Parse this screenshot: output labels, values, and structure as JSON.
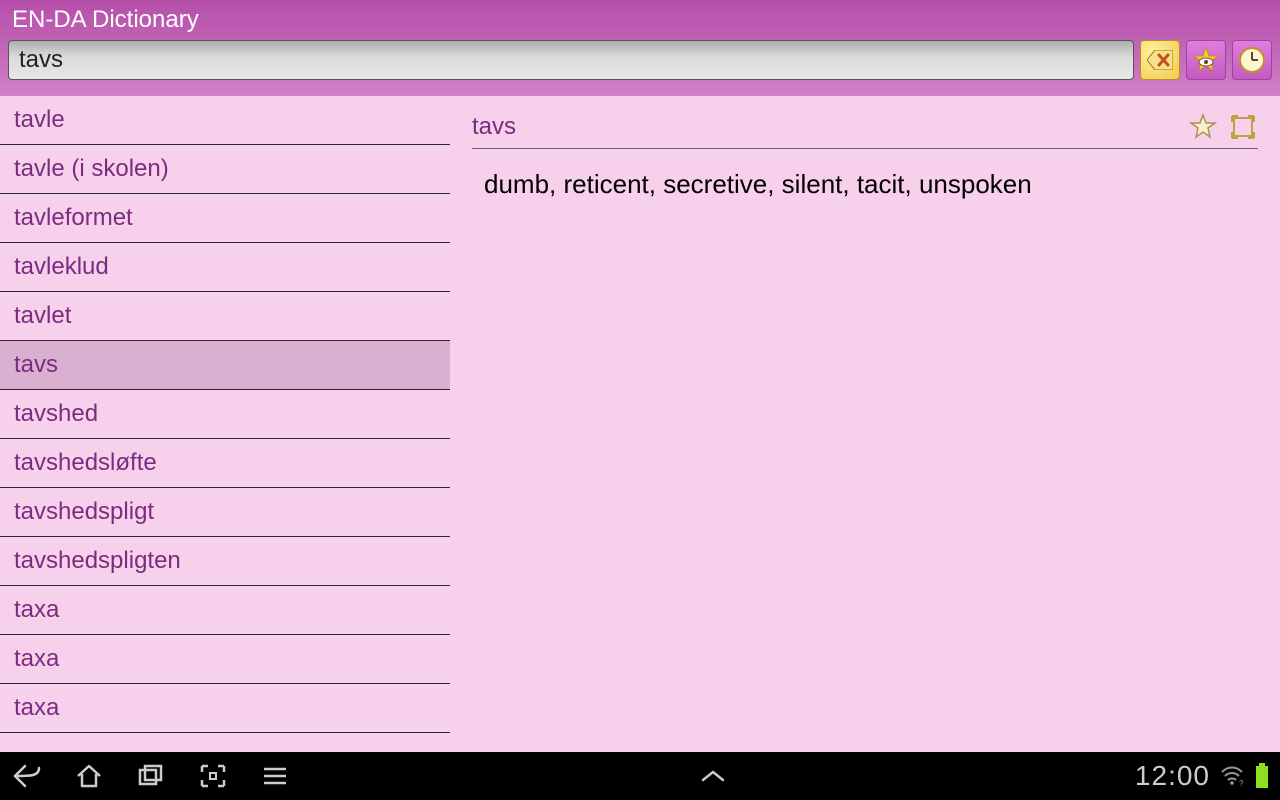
{
  "header": {
    "title": "EN-DA Dictionary",
    "search_value": "tavs"
  },
  "sidebar": {
    "items": [
      {
        "label": "tavle",
        "selected": false
      },
      {
        "label": "tavle (i skolen)",
        "selected": false
      },
      {
        "label": "tavleformet",
        "selected": false
      },
      {
        "label": "tavleklud",
        "selected": false
      },
      {
        "label": "tavlet",
        "selected": false
      },
      {
        "label": "tavs",
        "selected": true
      },
      {
        "label": "tavshed",
        "selected": false
      },
      {
        "label": "tavshedsløfte",
        "selected": false
      },
      {
        "label": "tavshedspligt",
        "selected": false
      },
      {
        "label": "tavshedspligten",
        "selected": false
      },
      {
        "label": "taxa",
        "selected": false
      },
      {
        "label": "taxa",
        "selected": false
      },
      {
        "label": "taxa",
        "selected": false
      }
    ]
  },
  "entry": {
    "word": "tavs",
    "definition": "dumb, reticent, secretive, silent, tacit, unspoken"
  },
  "statusbar": {
    "time": "12:00"
  }
}
